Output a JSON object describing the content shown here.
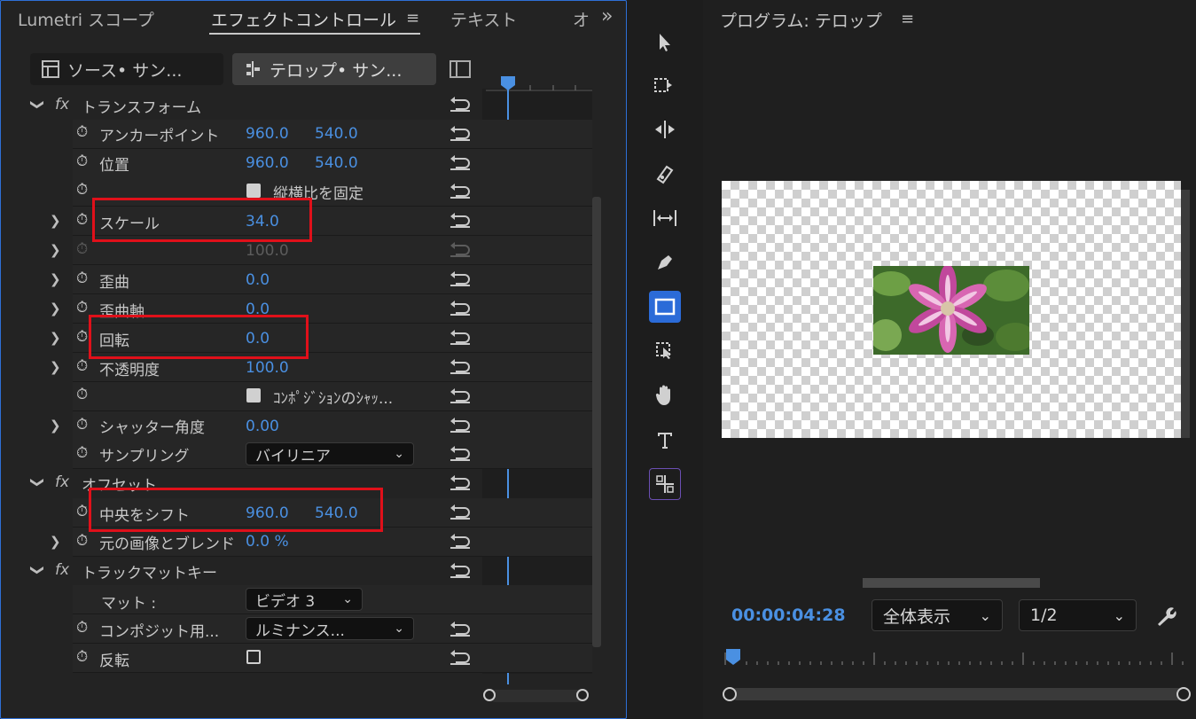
{
  "tabs": {
    "lumetri": "Lumetri スコープ",
    "effect_controls": "エフェクトコントロール",
    "text": "テキスト",
    "overflow": "オ",
    "more": "»",
    "menu": "≡"
  },
  "clips": {
    "source": "ソース• サン...",
    "sequence": "テロップ• サン..."
  },
  "sections": {
    "transform": "トランスフォーム",
    "offset": "オフセット",
    "track_matte": "トラックマットキー",
    "fx": "fx"
  },
  "transform": {
    "anchor_label": "アンカーポイント",
    "anchor_x": "960.0",
    "anchor_y": "540.0",
    "position_label": "位置",
    "position_x": "960.0",
    "position_y": "540.0",
    "uniform_label": "縦横比を固定",
    "scale_label": "スケール",
    "scale_value": "34.0",
    "scale_width_value": "100.0",
    "skew_label": "歪曲",
    "skew_value": "0.0",
    "skew_axis_label": "歪曲軸",
    "skew_axis_value": "0.0",
    "rotation_label": "回転",
    "rotation_value": "0.0",
    "opacity_label": "不透明度",
    "opacity_value": "100.0",
    "comp_shutter_label": "ｺﾝﾎﾟｼﾞｼｮﾝのｼｬｯ...",
    "shutter_angle_label": "シャッター角度",
    "shutter_angle_value": "0.00",
    "sampling_label": "サンプリング",
    "sampling_value": "バイリニア"
  },
  "offset": {
    "shift_label": "中央をシフト",
    "shift_x": "960.0",
    "shift_y": "540.0",
    "blend_label": "元の画像とブレンド",
    "blend_value": "0.0 %"
  },
  "track_matte": {
    "matte_label": "マット :",
    "matte_value": "ビデオ 3",
    "composite_label": "コンポジット用...",
    "composite_value": "ルミナンス...",
    "reverse_label": "反転"
  },
  "program": {
    "title": "プログラム: テロップ",
    "menu": "≡",
    "timecode": "00:00:04:28",
    "zoom": "全体表示",
    "resolution": "1/2"
  },
  "colors": {
    "accent": "#4a90e2",
    "highlight": "#e0101a",
    "panel_border": "#2e6fd6"
  }
}
